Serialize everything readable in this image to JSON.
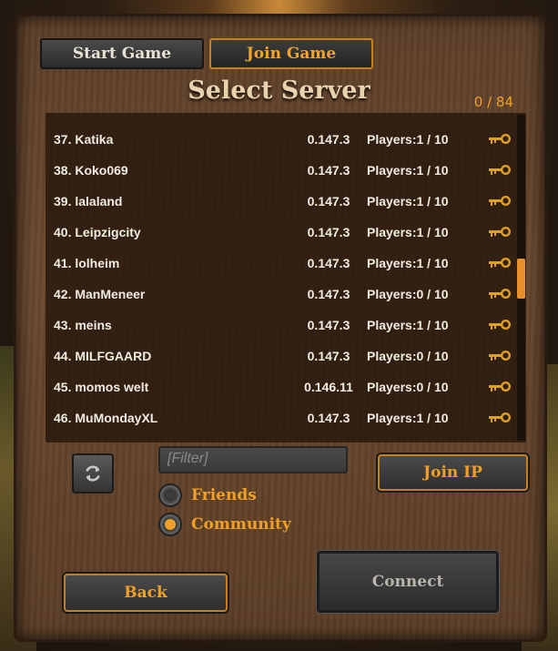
{
  "tabs": {
    "start_game": "Start Game",
    "join_game": "Join Game"
  },
  "title": "Select Server",
  "server_count": "0 / 84",
  "servers": [
    {
      "name": "37. Katika",
      "version": "0.147.3",
      "players": "Players:1 / 10"
    },
    {
      "name": "38. Koko069",
      "version": "0.147.3",
      "players": "Players:1 / 10"
    },
    {
      "name": "39. lalaland",
      "version": "0.147.3",
      "players": "Players:1 / 10"
    },
    {
      "name": "40. Leipzigcity",
      "version": "0.147.3",
      "players": "Players:1 / 10"
    },
    {
      "name": "41. lolheim",
      "version": "0.147.3",
      "players": "Players:1 / 10"
    },
    {
      "name": "42. ManMeneer",
      "version": "0.147.3",
      "players": "Players:0 / 10"
    },
    {
      "name": "43. meins",
      "version": "0.147.3",
      "players": "Players:1 / 10"
    },
    {
      "name": "44. MILFGAARD",
      "version": "0.147.3",
      "players": "Players:0 / 10"
    },
    {
      "name": "45. momos welt",
      "version": "0.146.11",
      "players": "Players:0 / 10"
    },
    {
      "name": "46. MuMondayXL",
      "version": "0.147.3",
      "players": "Players:1 / 10"
    }
  ],
  "filter": {
    "placeholder": "[Filter]",
    "value": ""
  },
  "radios": {
    "friends": {
      "label": "Friends",
      "selected": false
    },
    "community": {
      "label": "Community",
      "selected": true
    }
  },
  "buttons": {
    "join_ip": "Join IP",
    "back": "Back",
    "connect": "Connect"
  },
  "colors": {
    "accent": "#f0a028",
    "text": "#f1ece2",
    "key": "#e0a020"
  },
  "icons": {
    "refresh": "refresh-icon",
    "key": "key-icon"
  }
}
